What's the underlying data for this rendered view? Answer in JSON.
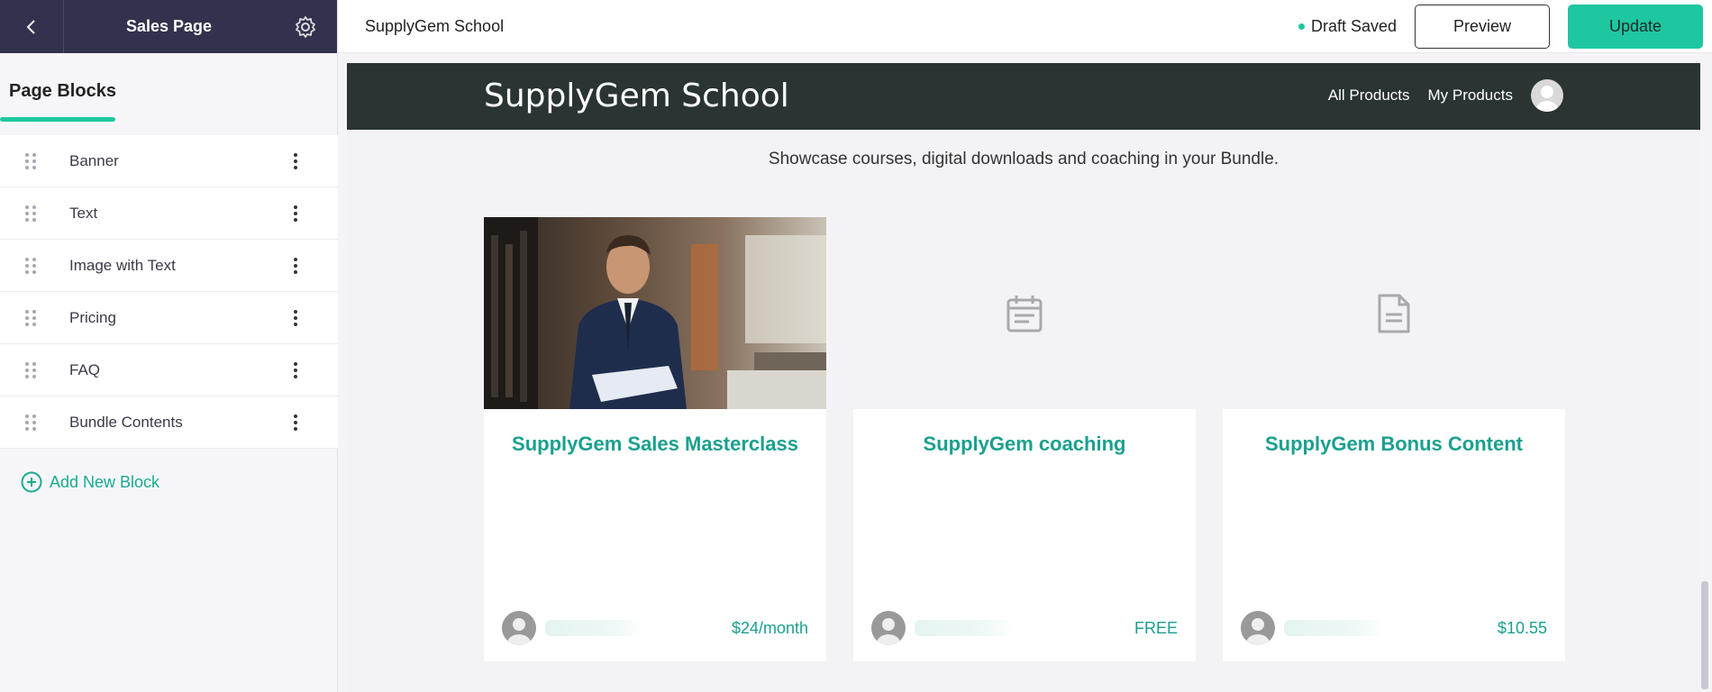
{
  "sidebar": {
    "title": "Sales Page",
    "tab": "Page Blocks",
    "blocks": [
      {
        "label": "Banner"
      },
      {
        "label": "Text"
      },
      {
        "label": "Image with Text"
      },
      {
        "label": "Pricing"
      },
      {
        "label": "FAQ"
      },
      {
        "label": "Bundle Contents"
      }
    ],
    "add_block": "Add New Block"
  },
  "topbar": {
    "site_name": "SupplyGem School",
    "status": "Draft Saved",
    "preview_label": "Preview",
    "update_label": "Update"
  },
  "preview": {
    "school_title": "SupplyGem School",
    "nav": [
      "All Products",
      "My Products"
    ],
    "subtitle": "Showcase courses, digital downloads and coaching in your Bundle.",
    "cards": [
      {
        "title": "SupplyGem Sales Masterclass",
        "price": "$24/month",
        "media": "photo"
      },
      {
        "title": "SupplyGem coaching",
        "price": "FREE",
        "media": "calendar-icon"
      },
      {
        "title": "SupplyGem Bonus Content",
        "price": "$10.55",
        "media": "document-icon"
      }
    ]
  },
  "colors": {
    "accent": "#1fc7a0",
    "sidebar_header": "#32324f",
    "preview_header": "#2a3433",
    "card_title": "#1aa08e"
  }
}
